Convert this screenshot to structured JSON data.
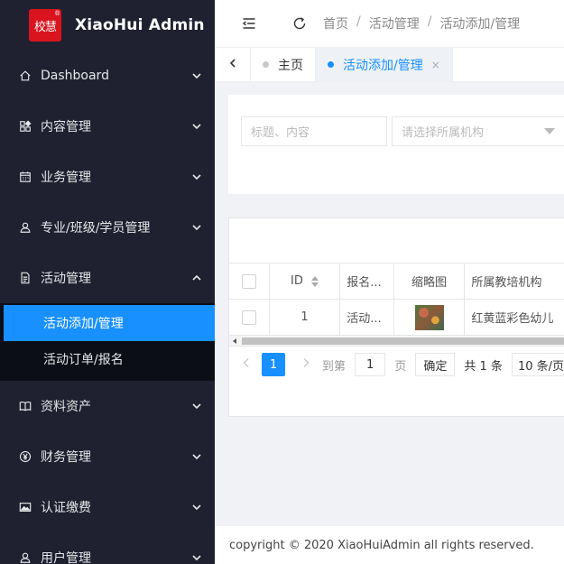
{
  "brand": {
    "logo_text": "校慧",
    "logo_mark": "®",
    "name": "XiaoHui Admin"
  },
  "sidebar": {
    "items": [
      {
        "label": "Dashboard",
        "icon": "home-icon",
        "expanded": false
      },
      {
        "label": "内容管理",
        "icon": "apps-icon",
        "expanded": false
      },
      {
        "label": "业务管理",
        "icon": "calendar-icon",
        "expanded": false
      },
      {
        "label": "专业/班级/学员管理",
        "icon": "user-icon",
        "expanded": false
      },
      {
        "label": "活动管理",
        "icon": "document-icon",
        "expanded": true
      },
      {
        "label": "资料资产",
        "icon": "book-icon",
        "expanded": false
      },
      {
        "label": "财务管理",
        "icon": "yen-icon",
        "expanded": false
      },
      {
        "label": "认证缴费",
        "icon": "image-icon",
        "expanded": false
      },
      {
        "label": "用户管理",
        "icon": "user-icon",
        "expanded": false
      }
    ],
    "submenu": [
      {
        "label": "活动添加/管理",
        "active": true
      },
      {
        "label": "活动订单/报名",
        "active": false
      }
    ]
  },
  "header": {
    "breadcrumb": [
      "首页",
      "活动管理",
      "活动添加/管理"
    ],
    "separator": "/"
  },
  "tabs": [
    {
      "label": "主页",
      "active": false
    },
    {
      "label": "活动添加/管理",
      "active": true,
      "close": "×"
    }
  ],
  "search": {
    "keyword_placeholder": "标题、内容",
    "org_placeholder": "请选择所属机构"
  },
  "table": {
    "columns": [
      "ID",
      "报名...",
      "缩略图",
      "所属教培机构"
    ],
    "rows": [
      {
        "id": "1",
        "signup": "活动...",
        "org": "红黄蓝彩色幼儿"
      }
    ]
  },
  "pagination": {
    "current_page": "1",
    "goto_label": "到第",
    "goto_value": "1",
    "page_label": "页",
    "confirm_label": "确定",
    "total_label": "共 1 条",
    "page_size_label": "10 条/页"
  },
  "footer": {
    "copyright": "copyright © 2020 XiaoHuiAdmin all rights reserved."
  },
  "colors": {
    "sidebar_bg": "#1f2130",
    "submenu_bg": "#0b0d17",
    "accent": "#1890ff",
    "logo_red": "#d9141e"
  }
}
